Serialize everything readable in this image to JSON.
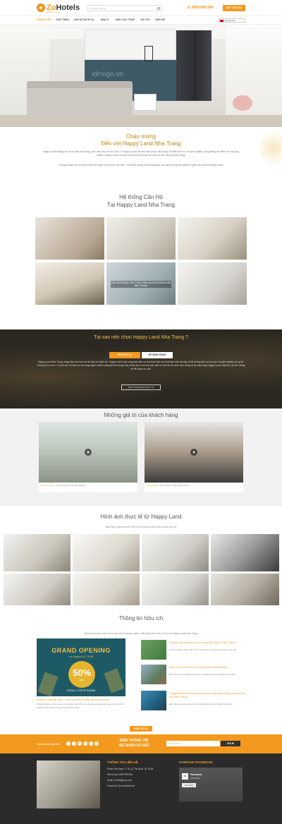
{
  "header": {
    "logo_prefix": "Zo",
    "logo_name": "Hotels",
    "logo_sub": "Being home",
    "search_placeholder": "Tìm kiếm căn hộ",
    "phone": "0999.999.999",
    "book_label": "ĐẶT CĂN HỘ",
    "language": "Vietnamese"
  },
  "nav": [
    "TRANG CHỦ",
    "GIỚI THIỆU",
    "CĂN HỘ DỊCH VỤ",
    "NHÀ Ở",
    "NHÀ CHO THUÊ",
    "TIN TỨC",
    "LIÊN HỆ"
  ],
  "hero": {
    "watermark": "idesign.vn"
  },
  "welcome": {
    "title1": "Chào mừng",
    "title2": "Đến với Happy Land Nha Trang",
    "p1": "Happy Land không chỉ là nơi bạn sinh sống, làm việc hay nơi vui chơi. Ở Happy Land mọi thứ đều được xây dựng và thiết kế tỉ mỉ, chuyên nghiệp, xứng đáng với niềm tin của Quý Khách. Happy Land hướng tới là một chuỗi căn hộ dịch vụ cao cấp tại Nha Trang.",
    "p2": "Chúng tôi đem tới sự thoải mái, tiện nghi và an toàn cho bạn. Chúng tôi mong muốn mang lại cho bạn những trải nghiệm tuyệt vời nhất tại Happy Land."
  },
  "system": {
    "title1": "Hệ thống Căn Hộ",
    "title2": "Tại Happy Land Nha Trang",
    "highlight_caption": "CĂN HỘ PHÒNG CHO THUÊ TRÊN ĐƯỜNG ĐỒNG KHỞI NHA TRANG"
  },
  "why": {
    "title": "Tại sao nên chọn Happy Land Nha Trang ?",
    "tab1": "VỀ DỊCH VỤ",
    "tab2": "VỀ SINH SỐNG",
    "text": "Happy Land Nha Trang mang đến cho bạn cơ hội đầu tư tuyệt vời. Happy Land luôn cung cấp dịch vụ cho thuê căn hộ với khách sạn hạ cấp và hệ thống dịch vụ trọn gói, chuyên nghiệp và uy tín. Chúng tôi có hơn 7 chuỗi căn hộ dịch vụ với hàng nghìn khách hàng đã tin tưởng. Đây chính là cơ hội cho bạn đầu tư sinh lời ổn định, bền vững và lâu dài cùng Happy Land. Hãy liên hệ với chúng tôi để được tư vấn.",
    "button": "TRỞ THÀNH NHÀ ĐẦU TƯ"
  },
  "testimonials": {
    "title": "Những giá trị của khách hàng",
    "items": [
      {
        "name": "Paulina Shang",
        "text": "Câu chuyện về đỗ giáo Paulina"
      },
      {
        "name": "Paulo Mayo",
        "text": "Câu chuyện về đỗ giáo Paulina"
      }
    ]
  },
  "photos": {
    "title": "Hình ảnh thực tế từ Happy Land",
    "subtitle": "Bạn hãy cùng xem hình ảnh thực tế được chụp hình tại các căn hộ"
  },
  "useful": {
    "title": "Thông tin hữu ích",
    "subtitle": "Những thông tin hữu ích và cập nhật thường xuyên, nhằm giúp bạn hiểu rõ hơn về Happy Land Nha Trang",
    "banner": {
      "line1": "GRAND OPENING",
      "line2": "on August 15, 2018",
      "percent": "50%",
      "off": "OFF",
      "line3": "FOR ALL TYPE OF ROOMS"
    },
    "main_title": "Khuyến mãi hấp dẫn - Giảm giá 50% nhân dịp khai trương",
    "main_text": "Nhân dịp khai trương, Happy Land giảm giá 50% cho tất cả các loại phòng, bạn có cơ hội trải nghiệm dịch vụ căn hộ cao cấp tại Nha Trang...",
    "side": [
      {
        "title": "Dường vào đảm sen hoa lộ tạo bất ngờ ở Nha Trang",
        "text": "Từ các đường nhiều năm mới ở Nha Trang, chúng tôi đã xây dựng nên..."
      },
      {
        "title": "Đính thự ven biển Nha Trang của vua Bảo Đại",
        "text": "Đính thự ven biển Nha Trang của vua Bảo Đại được xây dựng từ năm..."
      },
      {
        "title": "2 ngày check in những khách sạn đẹp nhất Trong chuyến du lịch Nha Trang",
        "text": "Hãy cùng chúng tôi check in những khách sạn đẹp nhất Nha Trang..."
      }
    ],
    "more": "XEM TẤT CẢ"
  },
  "subscribe": {
    "follow": "THEO DÕI CHÚNG TÔI",
    "title1": "ĐIỀN THÔNG TIN",
    "title2": "ĐỂ NHẬN ƯU ĐÃI",
    "placeholder": "Địa chỉ email",
    "button": "GỬI ĐI"
  },
  "footer": {
    "contact_title": "THÔNG TIN LIÊN HỆ",
    "address": "Phạm Văn Sạch, P. 15, Q. Tân Bình, Tp. HCM",
    "phone": "Điện thoại: 0999.999.999",
    "email": "Email: email@gmail.com",
    "facebook": "Facebook: fb.com/facebook",
    "fanpage_title": "FANPAGE FACEBOOK",
    "fb_name": "Facebook",
    "fb_likes": "142M likes",
    "fb_button": "Like Page"
  }
}
